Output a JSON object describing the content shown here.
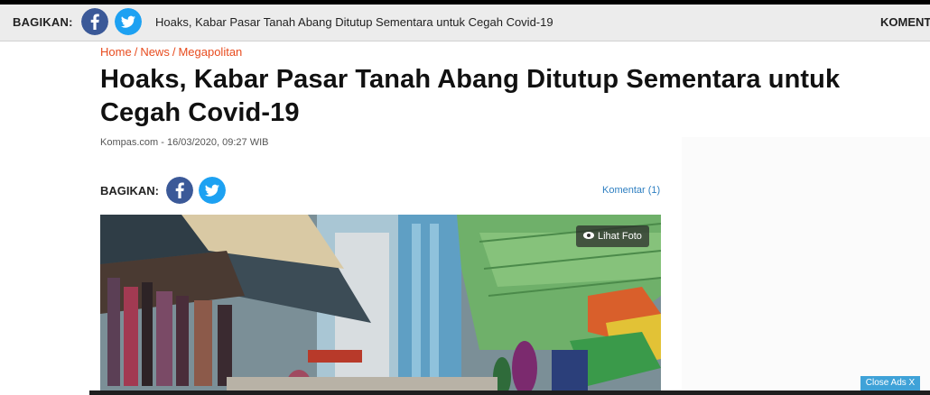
{
  "sticky_bar": {
    "share_label": "BAGIKAN:",
    "title": "Hoaks, Kabar Pasar Tanah Abang Ditutup Sementara untuk Cegah Covid-19",
    "comments_label": "KOMENTAR"
  },
  "breadcrumb": {
    "items": [
      "Home",
      "News",
      "Megapolitan"
    ],
    "separator": "/"
  },
  "article": {
    "title": "Hoaks, Kabar Pasar Tanah Abang Ditutup Sementara untuk Cegah Covid-19",
    "meta": "Kompas.com - 16/03/2020, 09:27 WIB"
  },
  "share": {
    "label": "BAGIKAN:",
    "comments_link": "Komentar (1)"
  },
  "photo": {
    "view_label": "Lihat Foto"
  },
  "ads": {
    "close_label": "Close Ads X"
  },
  "icons": {
    "facebook": "facebook-icon",
    "twitter": "twitter-icon",
    "eye": "eye-icon"
  },
  "colors": {
    "facebook": "#3b5998",
    "twitter": "#1da1f2",
    "breadcrumb": "#e84c1f",
    "link": "#2e7fc1",
    "close_ads": "#3fa2d8"
  }
}
